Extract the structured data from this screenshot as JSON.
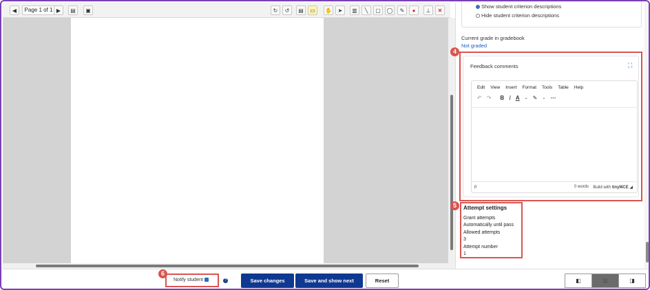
{
  "pdf_toolbar": {
    "prev_icon": "◀",
    "pager_label": "Page 1 of 1",
    "next_icon": "▶",
    "tools": [
      "↻",
      "↺",
      "▤",
      "▭",
      "✋",
      "➤",
      "▥",
      "╲",
      "▢",
      "◯",
      "✎",
      "●",
      "⊥",
      "✕"
    ]
  },
  "right_panel": {
    "criterion_show": "Show student criterion descriptions",
    "criterion_hide": "Hide student criterion descriptions",
    "grade_label": "Current grade in gradebook",
    "grade_value": "Not graded",
    "feedback": {
      "title": "Feedback comments",
      "menu": [
        "Edit",
        "View",
        "Insert",
        "Format",
        "Tools",
        "Table",
        "Help"
      ],
      "status_path": "p",
      "word_count": "0 words",
      "built_with": "Build with",
      "brand": "tinyMCE"
    },
    "attempt": {
      "heading": "Attempt settings",
      "grant_label": "Grant attempts",
      "grant_value": "Automatically until pass",
      "allowed_label": "Allowed attempts",
      "allowed_value": "3",
      "number_label": "Attempt number",
      "number_value": "1"
    }
  },
  "markers": {
    "m4": "4",
    "m5": "5",
    "m6": "6"
  },
  "bottom": {
    "notify_label": "Notify student",
    "save_changes": "Save changes",
    "save_next": "Save and show next",
    "reset": "Reset"
  },
  "colors": {
    "primary": "#0f3990",
    "highlight": "#d9534f",
    "link": "#1a5bbf",
    "frame": "#7b3fb5"
  }
}
